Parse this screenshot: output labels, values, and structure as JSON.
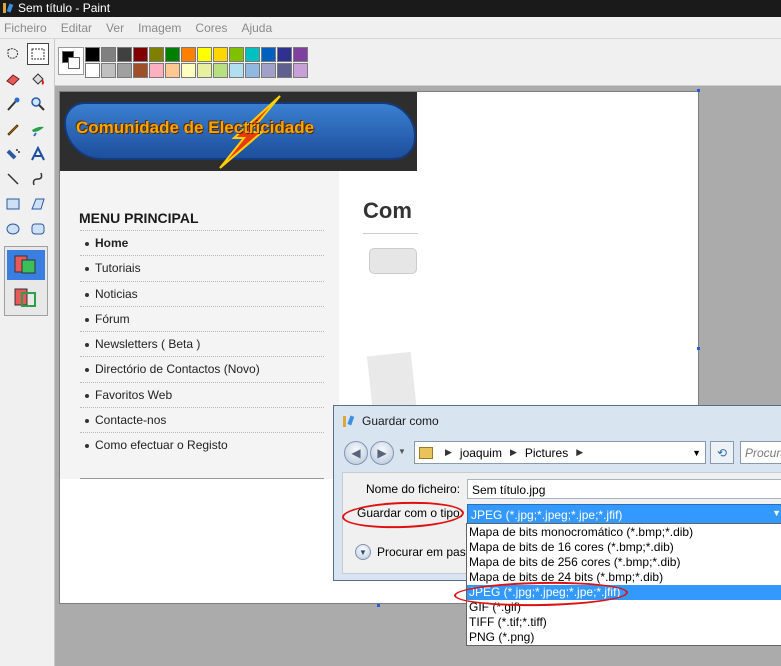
{
  "window": {
    "title": "Sem título - Paint"
  },
  "menubar": {
    "items": [
      "Ficheiro",
      "Editar",
      "Ver",
      "Imagem",
      "Cores",
      "Ajuda"
    ]
  },
  "tools": [
    "free-select-icon",
    "select-icon",
    "eraser-icon",
    "fill-icon",
    "color-picker-icon",
    "magnifier-icon",
    "pencil-icon",
    "brush-icon",
    "airbrush-icon",
    "text-icon",
    "line-icon",
    "curve-icon",
    "rectangle-icon",
    "polygon-icon",
    "ellipse-icon",
    "rounded-rectangle-icon"
  ],
  "palette": {
    "row1": [
      "#000000",
      "#808080",
      "#404040",
      "#800000",
      "#808000",
      "#008000",
      "#ff8000",
      "#ffff00",
      "#ffd700",
      "#80c000",
      "#00c0c0",
      "#0060c0",
      "#303090",
      "#8040a0"
    ],
    "row2": [
      "#ffffff",
      "#c0c0c0",
      "#a0a0a0",
      "#a05028",
      "#ffb0c0",
      "#ffc890",
      "#ffffc0",
      "#e8f0a0",
      "#b8e080",
      "#b0e0f0",
      "#90b8e0",
      "#a0a0c8",
      "#606090",
      "#c8a0d8"
    ]
  },
  "webpage": {
    "logo_text": "Comunidade de Electricidade",
    "menu_title": "MENU PRINCIPAL",
    "menu_items": [
      "Home",
      "Tutoriais",
      "Noticias",
      "Fórum",
      "Newsletters ( Beta )",
      "Directório de Contactos (Novo)",
      "Favoritos Web",
      "Contacte-nos",
      "Como efectuar o Registo"
    ],
    "heading": "Com"
  },
  "dialog": {
    "title": "Guardar como",
    "path": [
      "joaquim",
      "Pictures"
    ],
    "search_placeholder": "Procurar",
    "filename_label": "Nome do ficheiro:",
    "filename_value": "Sem título.jpg",
    "type_label": "Guardar com o tipo:",
    "type_value": "JPEG (*.jpg;*.jpeg;*.jpe;*.jfif)",
    "browse_label": "Procurar em pastas",
    "type_options": [
      "Mapa de bits monocromático (*.bmp;*.dib)",
      "Mapa de bits de 16 cores (*.bmp;*.dib)",
      "Mapa de bits de 256 cores (*.bmp;*.dib)",
      "Mapa de bits de 24 bits (*.bmp;*.dib)",
      "JPEG (*.jpg;*.jpeg;*.jpe;*.jfif)",
      "GIF (*.gif)",
      "TIFF (*.tif;*.tiff)",
      "PNG (*.png)"
    ],
    "selected_option_index": 4
  }
}
